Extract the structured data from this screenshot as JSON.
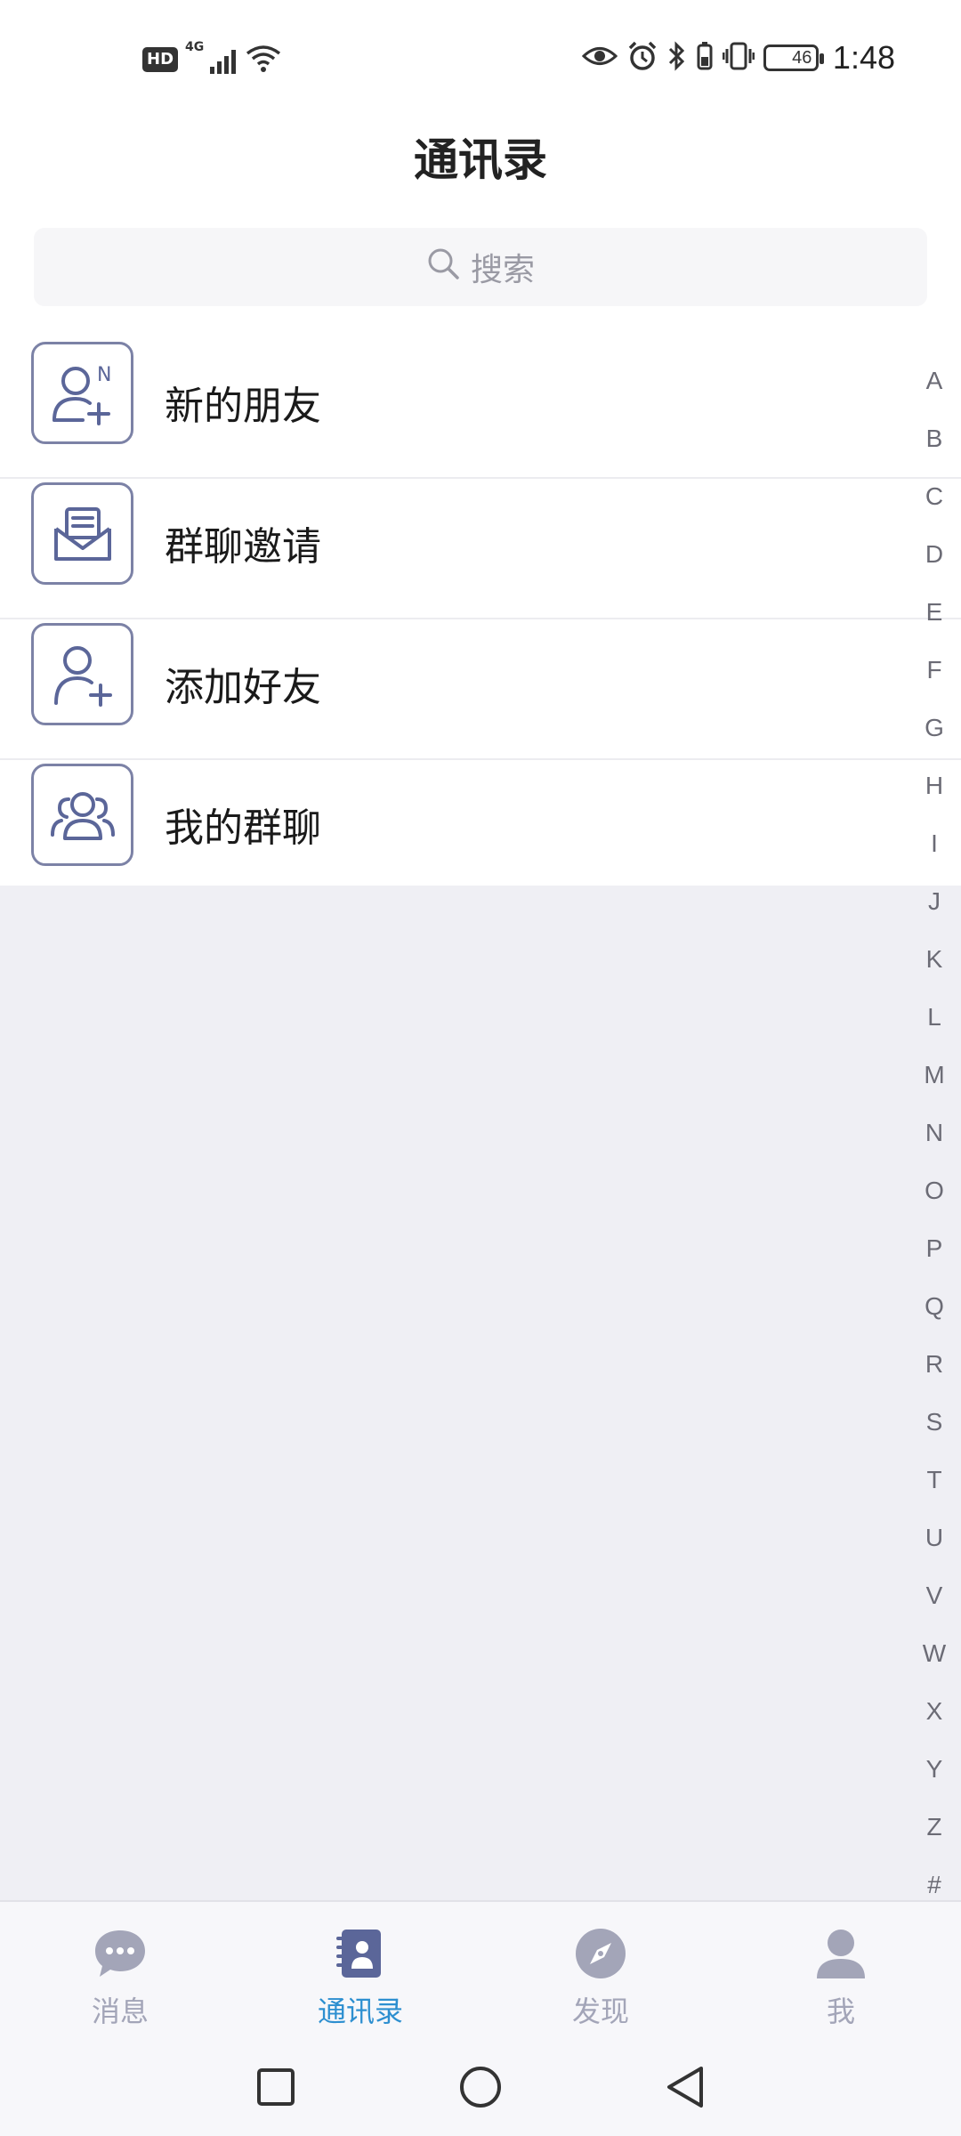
{
  "status_bar": {
    "left_badge": "HD",
    "network": "4G",
    "battery_level": "46",
    "time": "1:48"
  },
  "header": {
    "title": "通讯录"
  },
  "search": {
    "placeholder": "搜索"
  },
  "menu": {
    "items": [
      {
        "label": "新的朋友",
        "icon": "new-friend-icon"
      },
      {
        "label": "群聊邀请",
        "icon": "group-invite-icon"
      },
      {
        "label": "添加好友",
        "icon": "add-friend-icon"
      },
      {
        "label": "我的群聊",
        "icon": "my-groups-icon"
      }
    ]
  },
  "alpha_index": [
    "A",
    "B",
    "C",
    "D",
    "E",
    "F",
    "G",
    "H",
    "I",
    "J",
    "K",
    "L",
    "M",
    "N",
    "O",
    "P",
    "Q",
    "R",
    "S",
    "T",
    "U",
    "V",
    "W",
    "X",
    "Y",
    "Z",
    "#"
  ],
  "tabbar": {
    "tabs": [
      {
        "label": "消息",
        "icon": "chat-bubble-icon",
        "active": false
      },
      {
        "label": "通讯录",
        "icon": "contacts-book-icon",
        "active": true
      },
      {
        "label": "发现",
        "icon": "compass-icon",
        "active": false
      },
      {
        "label": "我",
        "icon": "person-icon",
        "active": false
      }
    ]
  },
  "colors": {
    "accent": "#2d8fd0",
    "icon_stroke": "#5b6699",
    "tab_inactive": "#a3a5b8",
    "background": "#efeff4"
  }
}
